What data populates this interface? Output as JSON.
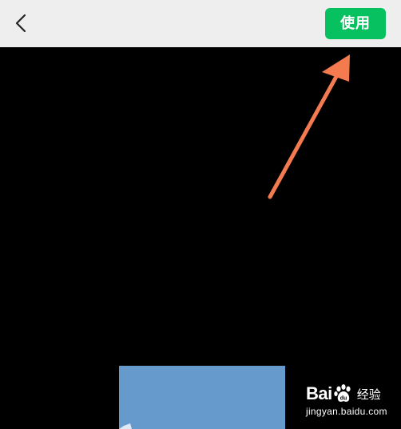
{
  "header": {
    "back_icon": "chevron-left-icon",
    "use_button_label": "使用"
  },
  "preview": {
    "color": "#6699cc"
  },
  "annotation": {
    "arrow_color": "#f47a50"
  },
  "watermark": {
    "brand_left": "Bai",
    "brand_right": "du",
    "brand_suffix": "经验",
    "url": "jingyan.baidu.com"
  },
  "colors": {
    "topbar": "#eeeeee",
    "accent_green": "#07c160",
    "background": "#000000"
  }
}
